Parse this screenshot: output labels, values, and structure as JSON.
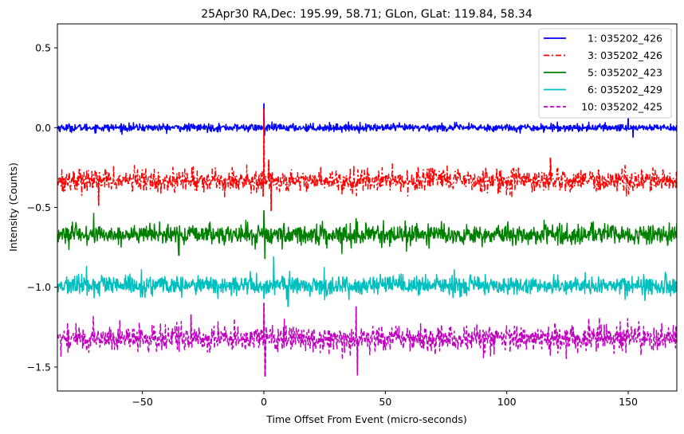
{
  "chart_data": {
    "type": "line",
    "title": "25Apr30 RA,Dec:  195.99,  58.71; GLon, GLat:  119.84,  58.34",
    "xlabel": "Time Offset From Event (micro-seconds)",
    "ylabel": "Intensity (Counts)",
    "xlim": [
      -85,
      170
    ],
    "ylim": [
      -1.65,
      0.65
    ],
    "xticks": [
      -50,
      0,
      50,
      100,
      150
    ],
    "xtick_labels": [
      "−50",
      "0",
      "50",
      "100",
      "150"
    ],
    "yticks": [
      0.5,
      0.0,
      -0.5,
      -1.0,
      -1.5
    ],
    "ytick_labels": [
      "0.5",
      "0.0",
      "−0.5",
      "−1.0",
      "−1.5"
    ],
    "grid": false,
    "legend_position": "top-right",
    "series": [
      {
        "name": "1: 035202_426",
        "color": "#0000ff",
        "style": "solid",
        "baseline": 0.0,
        "noise": 0.012,
        "spikes": [
          {
            "x": 0.0,
            "y": 0.15
          },
          {
            "x": 0.3,
            "y": -0.05
          },
          {
            "x": 150.0,
            "y": 0.06
          },
          {
            "x": 152.0,
            "y": -0.06
          }
        ]
      },
      {
        "name": "3: 035202_426",
        "color": "#ff0000",
        "style": "dashdot",
        "baseline": -0.33,
        "noise": 0.035,
        "spikes": [
          {
            "x": 0.0,
            "y": 0.12
          },
          {
            "x": -0.3,
            "y": -0.43
          },
          {
            "x": 2.0,
            "y": -0.2
          },
          {
            "x": 3.0,
            "y": -0.52
          },
          {
            "x": 118.0,
            "y": -0.19
          },
          {
            "x": -68.0,
            "y": -0.49
          }
        ]
      },
      {
        "name": "5: 035202_423",
        "color": "#008000",
        "style": "solid",
        "baseline": -0.67,
        "noise": 0.03,
        "spikes": [
          {
            "x": 0.0,
            "y": -0.52
          },
          {
            "x": 0.4,
            "y": -0.82
          },
          {
            "x": -35.0,
            "y": -0.8
          },
          {
            "x": 38.0,
            "y": -0.57
          }
        ]
      },
      {
        "name": "6: 035202_429",
        "color": "#00bfbf",
        "style": "solid",
        "baseline": -0.99,
        "noise": 0.03,
        "spikes": [
          {
            "x": 0.0,
            "y": -1.07
          },
          {
            "x": 4.0,
            "y": -0.81
          },
          {
            "x": -73.0,
            "y": -0.87
          },
          {
            "x": 10.0,
            "y": -1.12
          }
        ]
      },
      {
        "name": "10: 035202_425",
        "color": "#bf00bf",
        "style": "dashed",
        "baseline": -1.32,
        "noise": 0.04,
        "spikes": [
          {
            "x": 0.0,
            "y": -1.1
          },
          {
            "x": 0.5,
            "y": -1.56
          },
          {
            "x": 38.0,
            "y": -1.12
          },
          {
            "x": 38.5,
            "y": -1.55
          },
          {
            "x": -30.0,
            "y": -1.17
          }
        ]
      }
    ]
  }
}
